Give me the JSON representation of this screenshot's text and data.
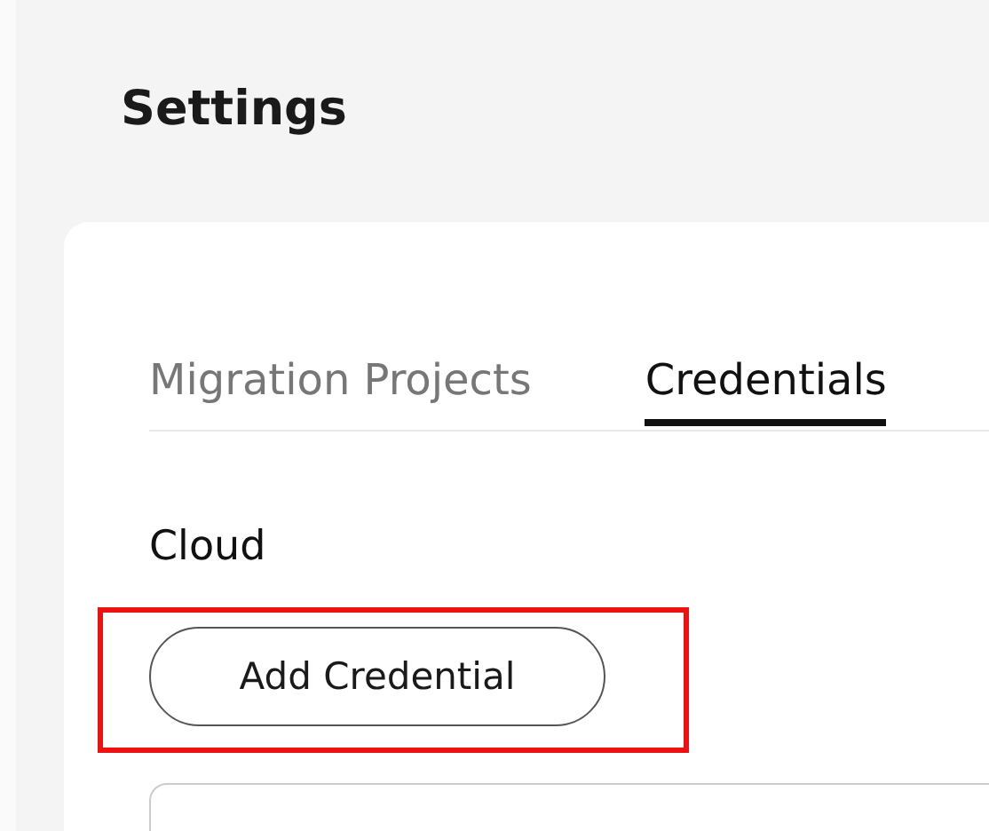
{
  "page": {
    "title": "Settings"
  },
  "tabs": [
    {
      "label": "Migration Projects",
      "selected": false
    },
    {
      "label": "Credentials",
      "selected": true
    }
  ],
  "section": {
    "title": "Cloud",
    "button": {
      "label": "Add Credential",
      "highlighted": true
    }
  }
}
